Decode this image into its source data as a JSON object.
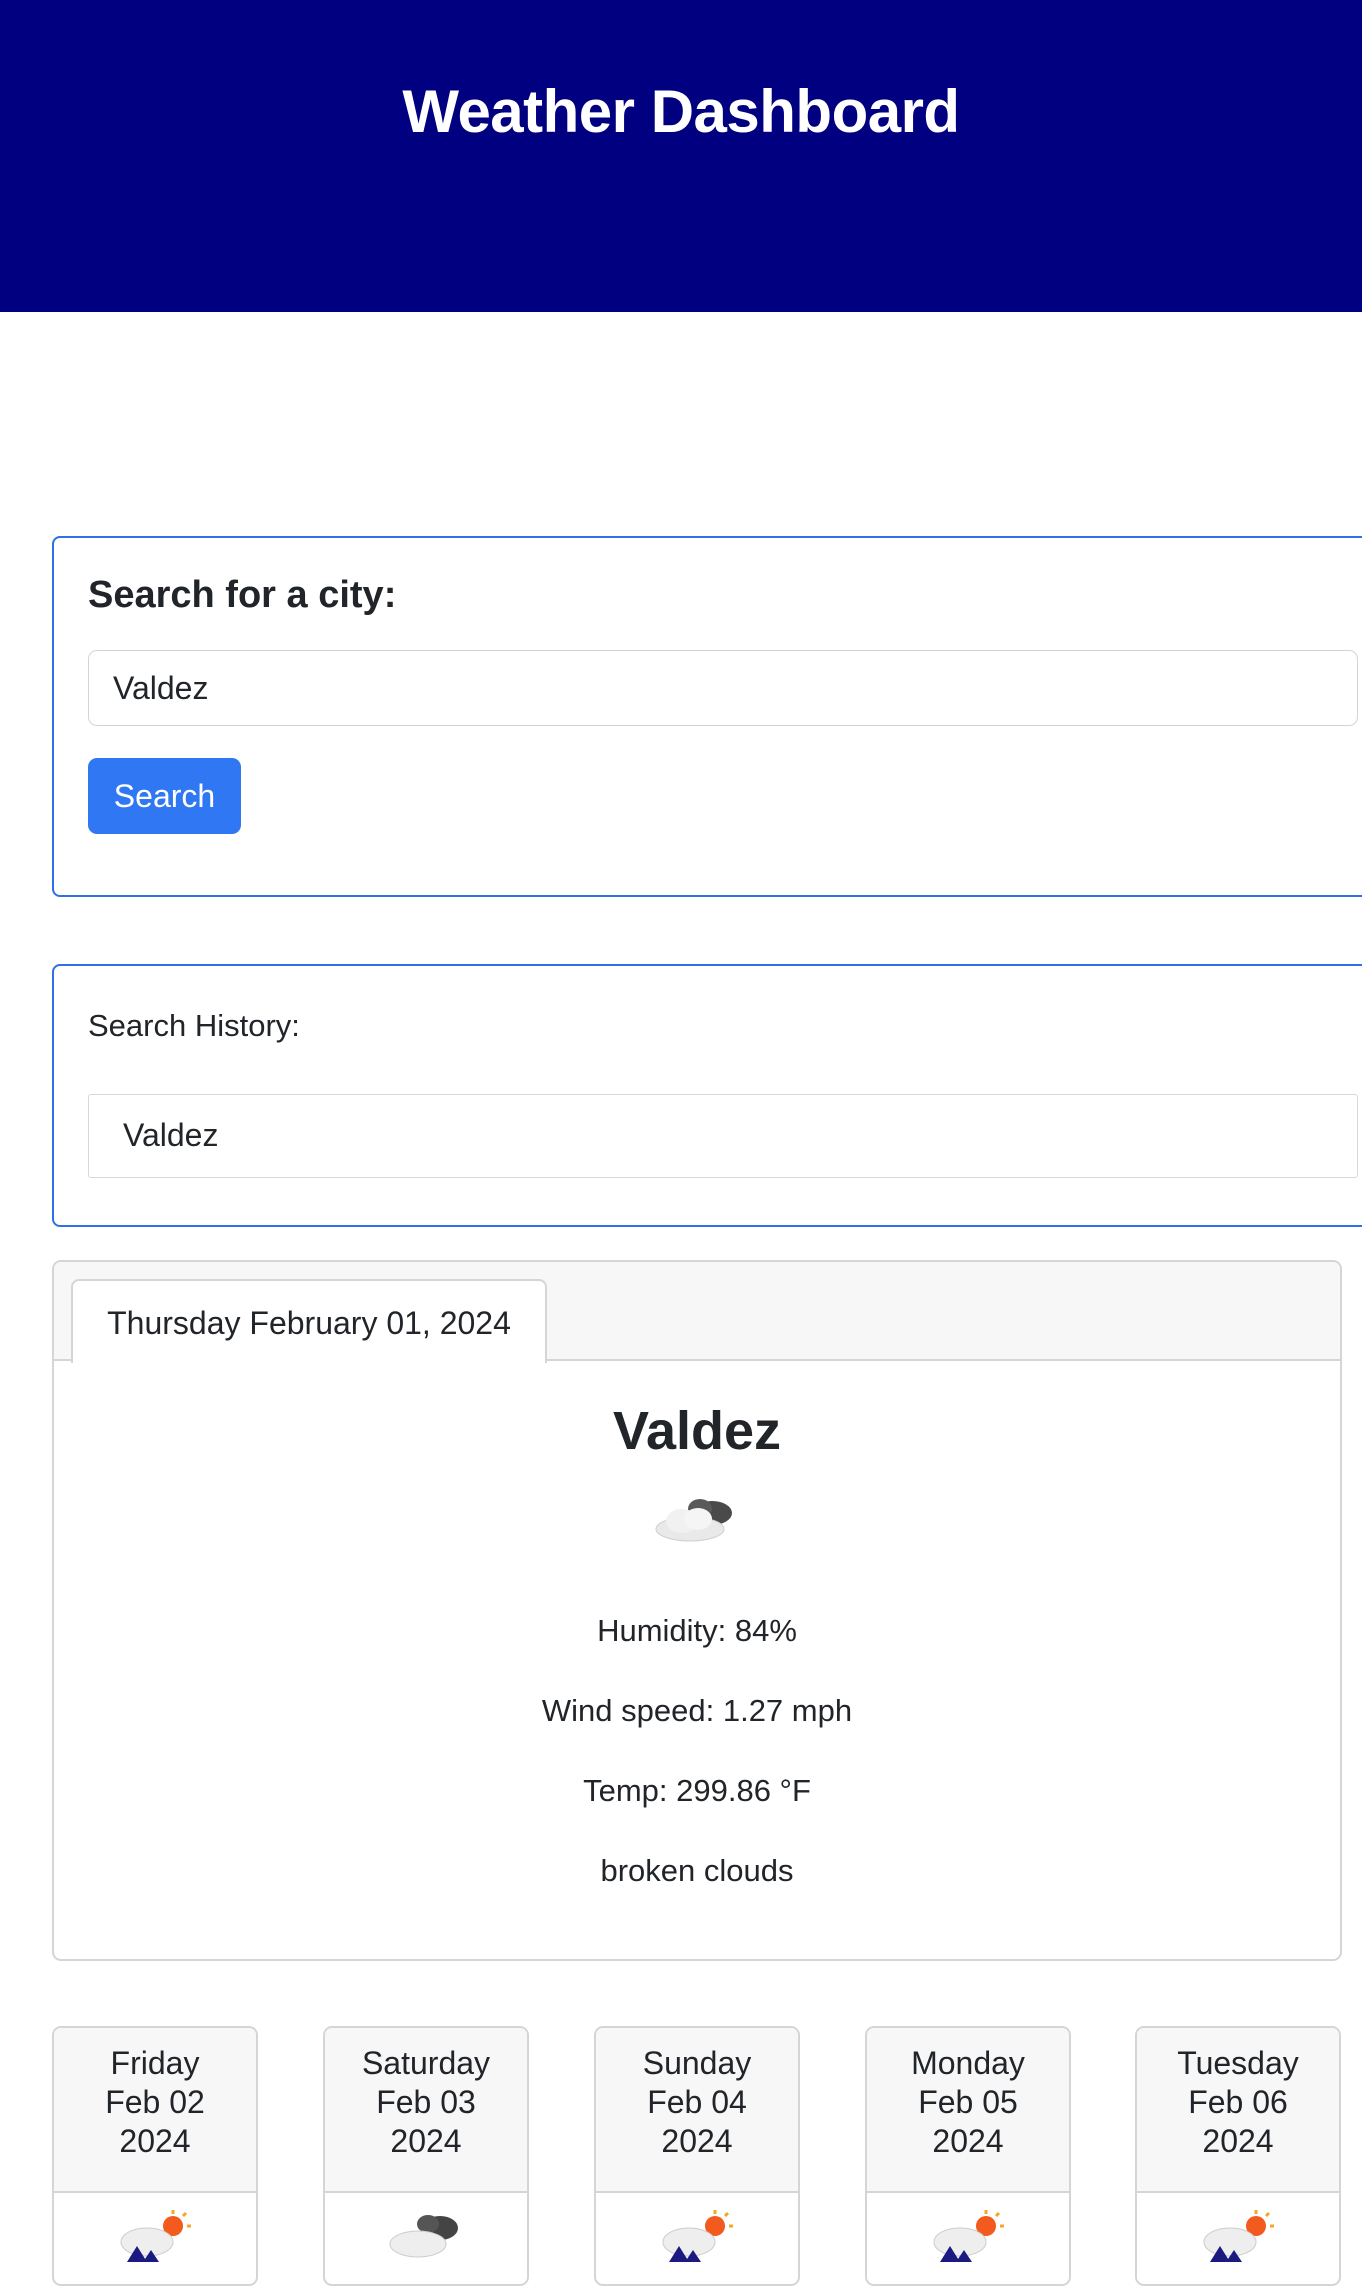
{
  "header": {
    "title": "Weather Dashboard"
  },
  "search": {
    "title": "Search for a city:",
    "input_value": "Valdez",
    "button_label": "Search"
  },
  "history": {
    "title": "Search History:",
    "items": [
      "Valdez"
    ]
  },
  "current": {
    "date": "Thursday February 01, 2024",
    "city": "Valdez",
    "icon": "broken-clouds-icon",
    "humidity": "Humidity: 84%",
    "wind": "Wind speed: 1.27 mph",
    "temp": "Temp: 299.86 °F",
    "description": "broken clouds"
  },
  "forecast": [
    {
      "day": "Friday",
      "date": "Feb 02",
      "year": "2024",
      "icon": "snow-sun-icon"
    },
    {
      "day": "Saturday",
      "date": "Feb 03",
      "year": "2024",
      "icon": "cloudy-icon"
    },
    {
      "day": "Sunday",
      "date": "Feb 04",
      "year": "2024",
      "icon": "snow-sun-icon"
    },
    {
      "day": "Monday",
      "date": "Feb 05",
      "year": "2024",
      "icon": "snow-sun-icon"
    },
    {
      "day": "Tuesday",
      "date": "Feb 06",
      "year": "2024",
      "icon": "snow-sun-icon"
    }
  ],
  "colors": {
    "header_bg": "#000080",
    "accent_border": "#2f6fe8",
    "button_bg": "#3077f4"
  }
}
